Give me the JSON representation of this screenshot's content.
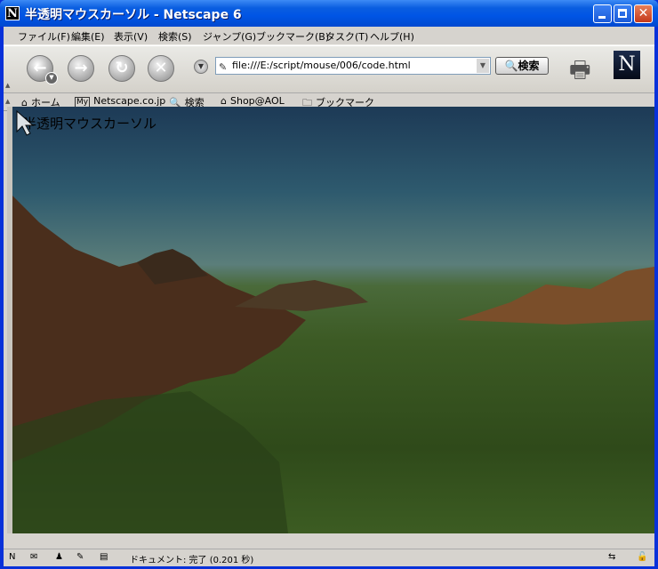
{
  "window": {
    "title": "半透明マウスカーソル - Netscape 6",
    "app_icon": "N"
  },
  "menu": [
    "ファイル(F)",
    "編集(E)",
    "表示(V)",
    "検索(S)",
    "ジャンプ(G)",
    "ブックマーク(B)",
    "タスク(T)",
    "ヘルプ(H)"
  ],
  "toolbar": {
    "url": "file:///E:/script/mouse/006/code.html",
    "search_label": "検索",
    "logo_letter": "N"
  },
  "personal_toolbar": [
    {
      "label": "ホーム",
      "icon": "home-icon"
    },
    {
      "label": "Netscape.co.jp",
      "icon": "my-icon"
    },
    {
      "label": "検索",
      "icon": "search-icon"
    },
    {
      "label": "Shop@AOL",
      "icon": "shop-icon"
    },
    {
      "label": "ブックマーク",
      "icon": "folder-icon"
    }
  ],
  "my_badge": "My",
  "page": {
    "text": "半透明マウスカーソル"
  },
  "status": {
    "text": "ドキュメント: 完了 (0.201 秒)"
  }
}
